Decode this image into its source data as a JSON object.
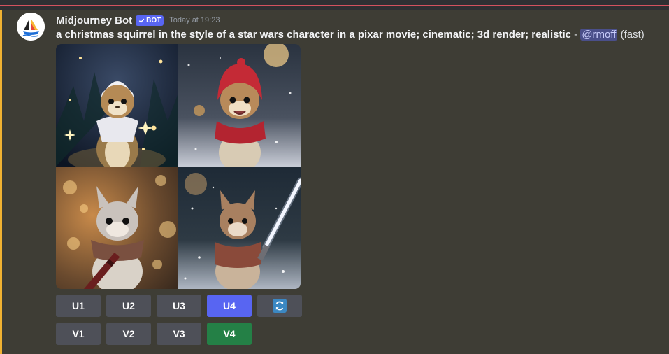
{
  "message": {
    "author": "Midjourney Bot",
    "bot_tag": "BOT",
    "timestamp": "Today at 19:23",
    "prompt": "a christmas squirrel in the style of a star wars character in a pixar movie; cinematic; 3d render; realistic",
    "separator": " - ",
    "mention": "@rmoff",
    "speed": "(fast)"
  },
  "image_grid": {
    "tiles": [
      {
        "description": "squirrel in white hood"
      },
      {
        "description": "squirrel in red hood and scarf"
      },
      {
        "description": "squirrel with brown scarf holding rod"
      },
      {
        "description": "squirrel with lightsaber"
      }
    ]
  },
  "buttons": {
    "row1": [
      {
        "label": "U1",
        "style": "secondary"
      },
      {
        "label": "U2",
        "style": "secondary"
      },
      {
        "label": "U3",
        "style": "secondary"
      },
      {
        "label": "U4",
        "style": "primary"
      },
      {
        "label": "",
        "icon": "reroll-icon",
        "style": "secondary"
      }
    ],
    "row2": [
      {
        "label": "V1",
        "style": "secondary"
      },
      {
        "label": "V2",
        "style": "secondary"
      },
      {
        "label": "V3",
        "style": "secondary"
      },
      {
        "label": "V4",
        "style": "success"
      }
    ]
  },
  "colors": {
    "background": "#3f3d36",
    "blurple": "#5865f2",
    "green": "#248046",
    "button_grey": "#4e5058",
    "mention_bar": "#f0b232"
  }
}
